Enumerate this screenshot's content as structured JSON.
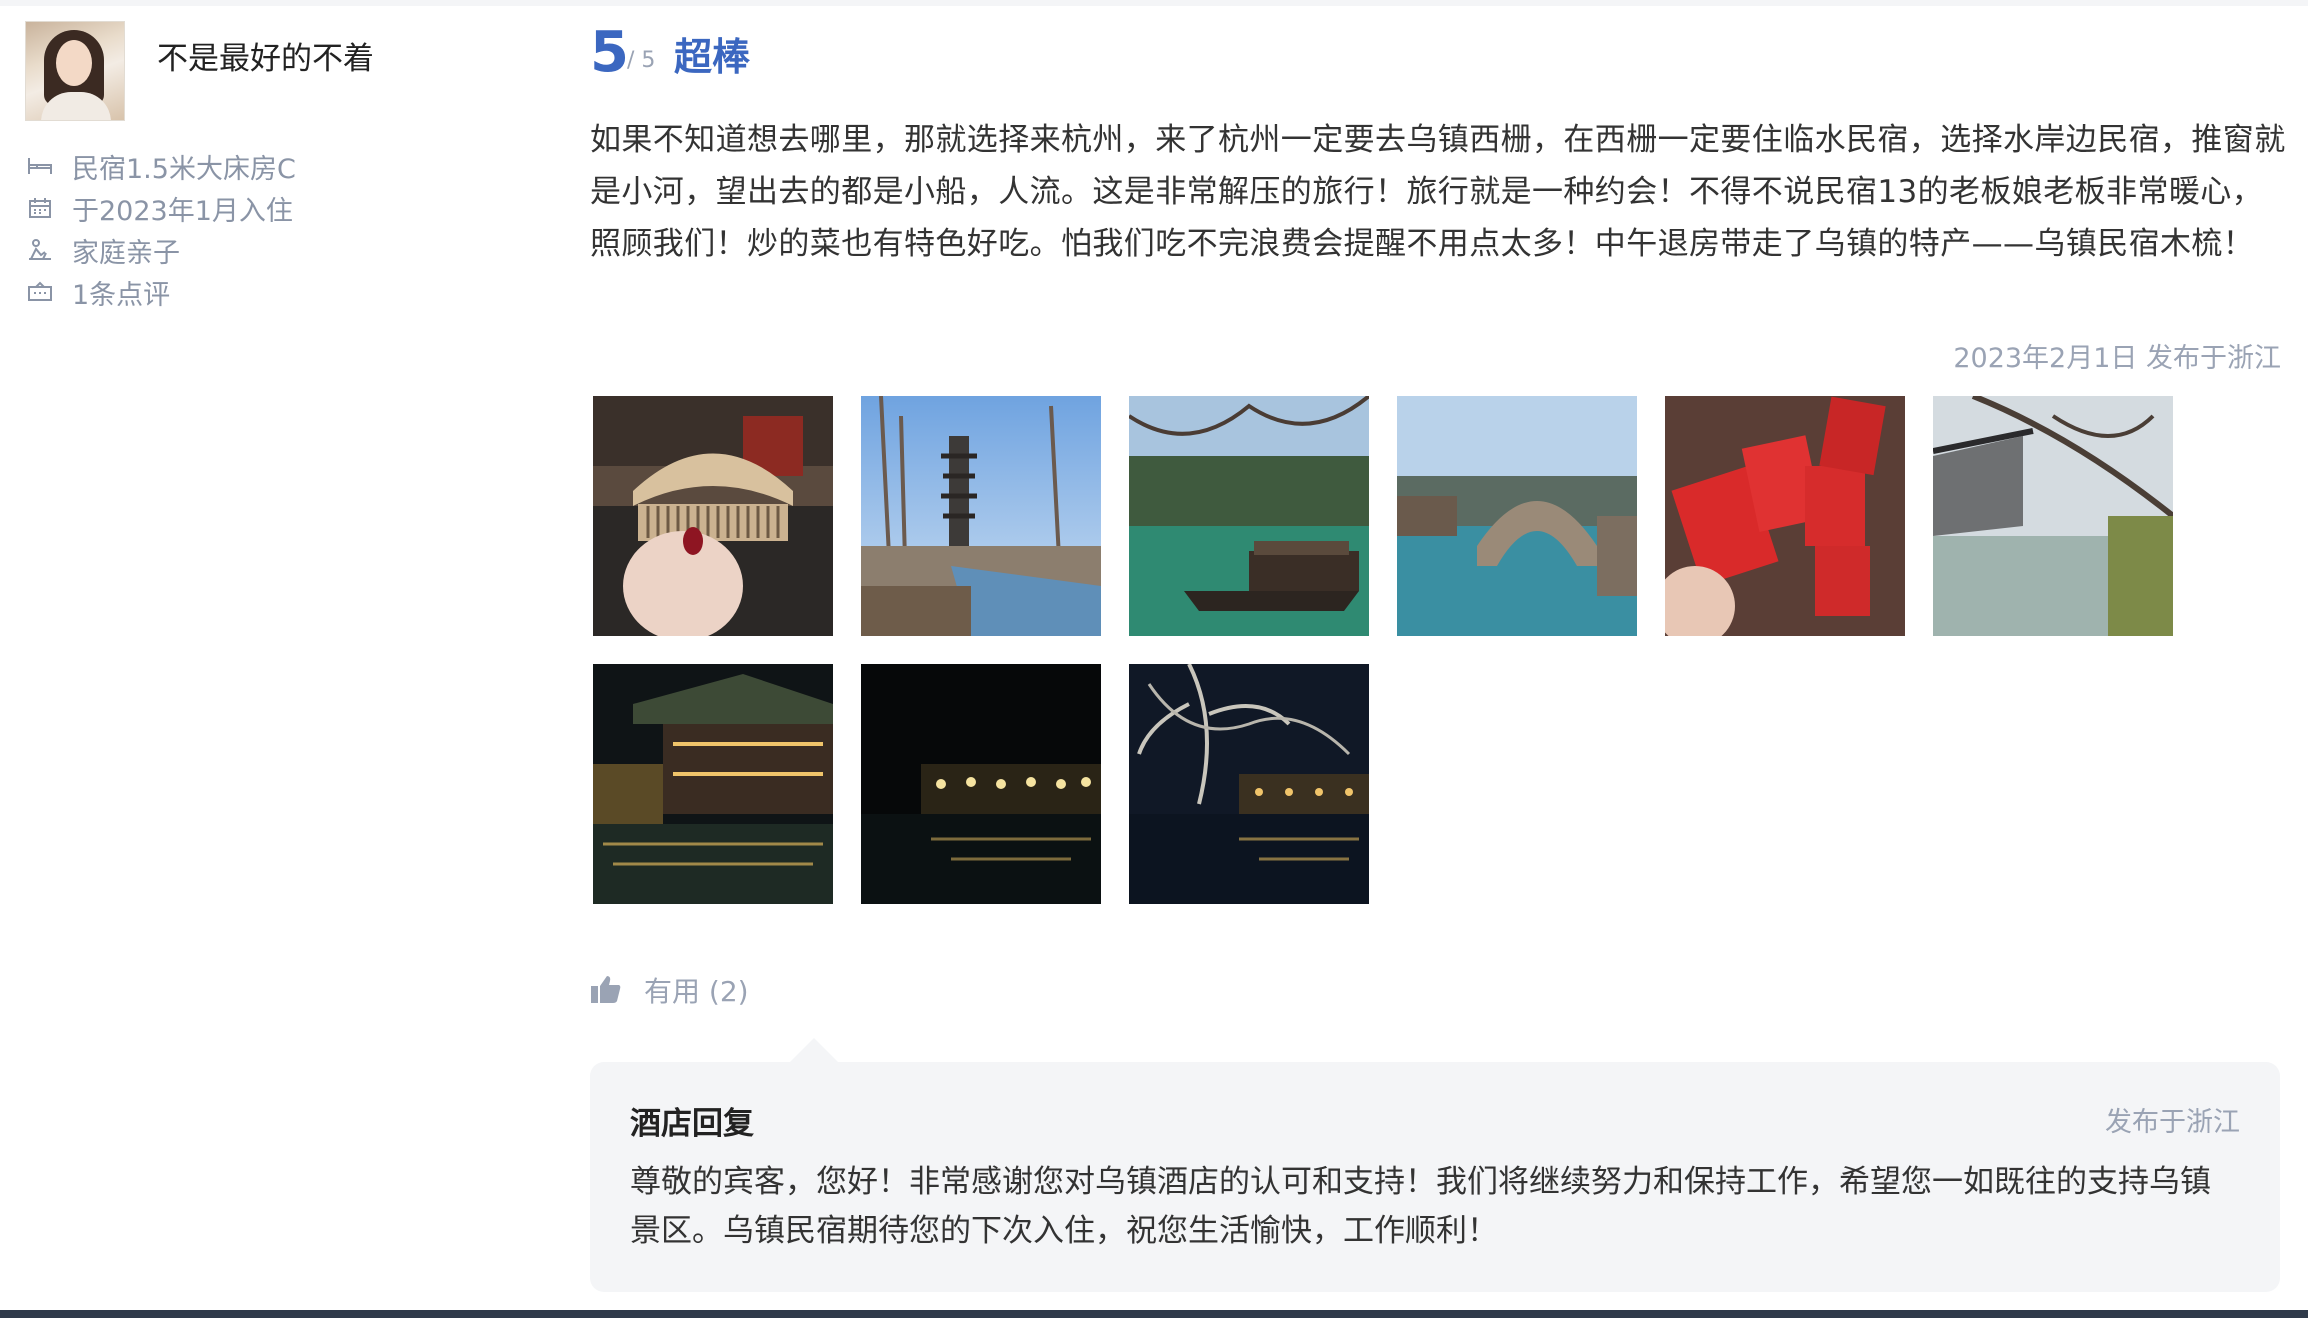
{
  "reviewer": {
    "name": "不是最好的不着",
    "room_type": "民宿1.5米大床房C",
    "checkin": "于2023年1月入住",
    "trip_type": "家庭亲子",
    "review_count": "1条点评"
  },
  "rating": {
    "score": "5",
    "max": "/ 5",
    "label": "超棒"
  },
  "review": {
    "text": "如果不知道想去哪里，那就选择来杭州，来了杭州一定要去乌镇西栅，在西栅一定要住临水民宿，选择水岸边民宿，推窗就是小河，望出去的都是小船，人流。这是非常解压的旅行！旅行就是一种约会！不得不说民宿13的老板娘老板非常暖心，照顾我们！炒的菜也有特色好吃。怕我们吃不完浪费会提醒不用点太多！中午退房带走了乌镇的特产——乌镇民宿木梳！",
    "posted": "2023年2月1日 发布于浙江"
  },
  "photos": [
    {
      "subject": "wooden-comb"
    },
    {
      "subject": "pagoda-canal"
    },
    {
      "subject": "green-canal-boat"
    },
    {
      "subject": "stone-bridge"
    },
    {
      "subject": "red-lanterns"
    },
    {
      "subject": "riverside-houses"
    },
    {
      "subject": "night-riverside-1"
    },
    {
      "subject": "night-riverside-2"
    },
    {
      "subject": "night-riverside-3"
    }
  ],
  "useful": {
    "label": "有用 (2)"
  },
  "reply": {
    "title": "酒店回复",
    "meta": "发布于浙江",
    "text": "尊敬的宾客，您好！非常感谢您对乌镇酒店的认可和支持！我们将继续努力和保持工作，希望您一如既往的支持乌镇景区。乌镇民宿期待您的下次入住，祝您生活愉快，工作顺利！"
  },
  "colors": {
    "accent": "#3b67c0",
    "muted": "#9aa3b4",
    "reply_bg": "#f4f5f7"
  }
}
